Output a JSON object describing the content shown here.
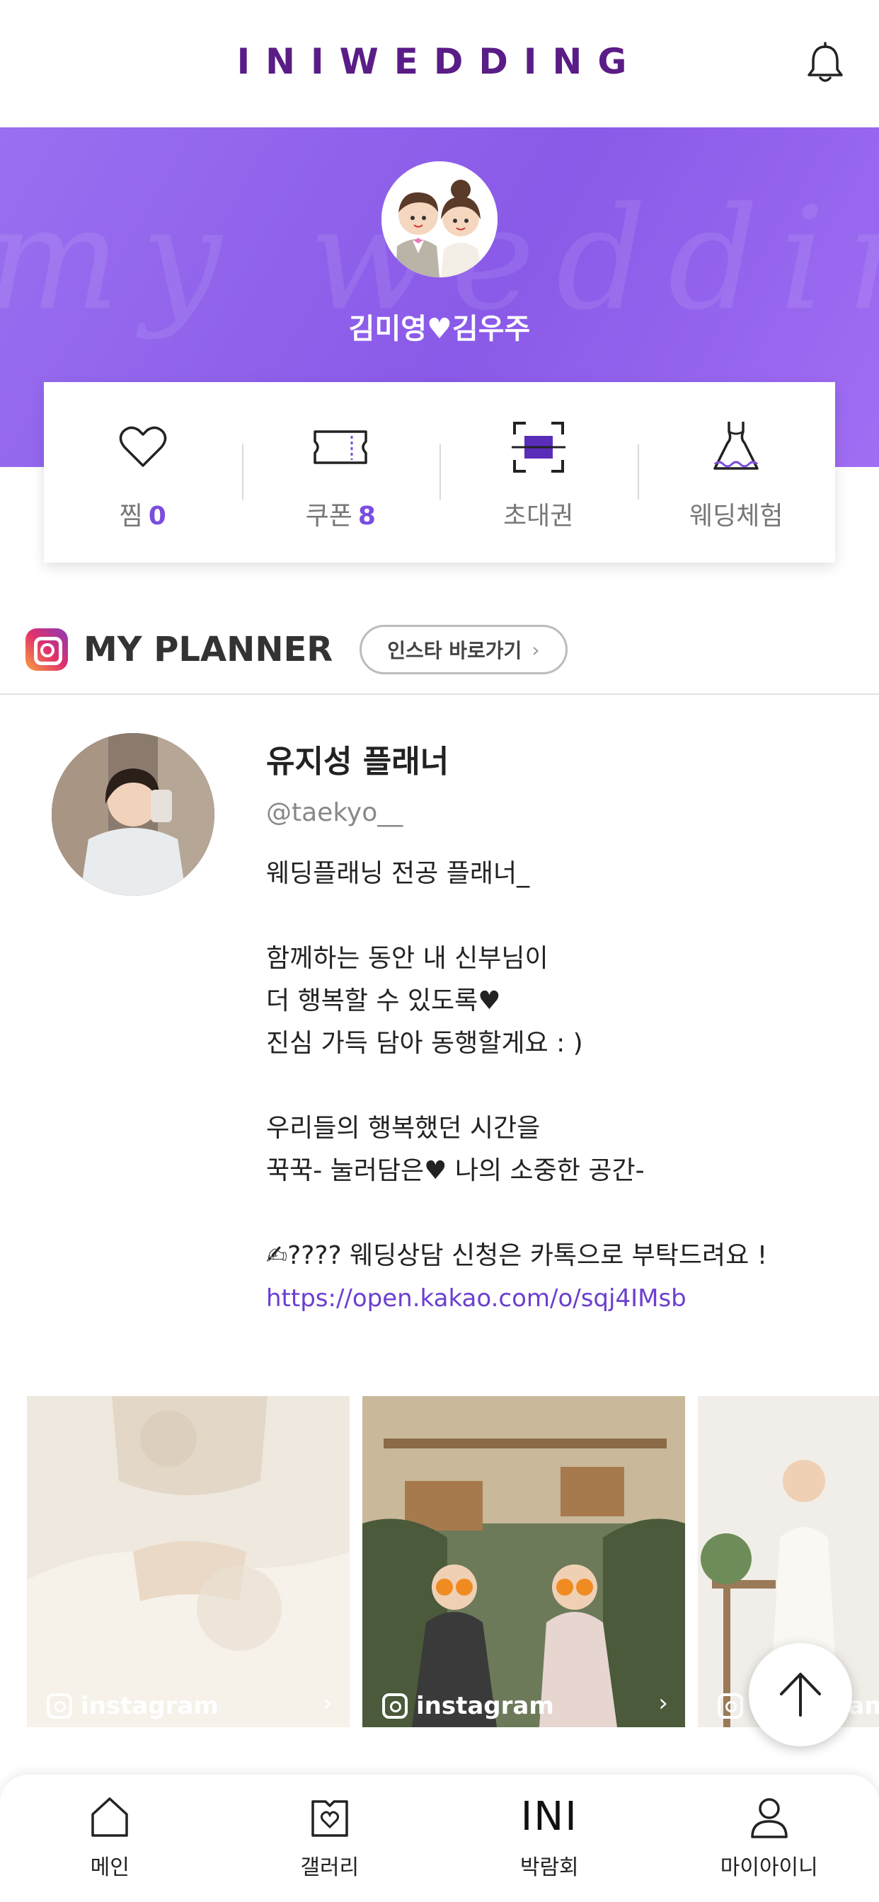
{
  "header": {
    "logo": "INIWEDDING",
    "bell_icon": "bell-icon"
  },
  "hero": {
    "background_script": "my wedding",
    "couple_name": "김미영♥김우주"
  },
  "stats": [
    {
      "icon": "heart-icon",
      "label": "찜",
      "count": "0"
    },
    {
      "icon": "ticket-icon",
      "label": "쿠폰",
      "count": "8"
    },
    {
      "icon": "invitation-icon",
      "label": "초대권",
      "count": ""
    },
    {
      "icon": "dress-icon",
      "label": "웨딩체험",
      "count": ""
    }
  ],
  "planner_section": {
    "title": "MY PLANNER",
    "insta_link": "인스타 바로가기",
    "chevron": "›"
  },
  "planner": {
    "name": "유지성 플래너",
    "handle": "@taekyo__",
    "bio": "웨딩플래닝 전공 플래너_\n\n함께하는 동안 내 신부님이\n더 행복할 수 있도록♥\n진심 가득 담아 동행할게요 : )\n\n우리들의 행복했던 시간을\n꾹꾹- 눌러담은♥ 나의 소중한 공간-\n\n✍???? 웨딩상담 신청은 카톡으로 부탁드려요 !",
    "link": "https://open.kakao.com/o/sqj4IMsb"
  },
  "gallery": [
    {
      "caption": "instagram",
      "chevron": "›"
    },
    {
      "caption": "instagram",
      "chevron": "›"
    },
    {
      "caption": "instagram",
      "chevron": "›"
    }
  ],
  "scroll_top_icon": "arrow-up-icon",
  "nav": [
    {
      "icon": "home-icon",
      "label": "메인"
    },
    {
      "icon": "gallery-icon",
      "label": "갤러리"
    },
    {
      "icon_text": "INI",
      "label": "박람회"
    },
    {
      "icon": "user-icon",
      "label": "마이아이니"
    }
  ],
  "colors": {
    "brand_purple": "#5a1c86",
    "hero_purple": "#8a5ae8",
    "accent": "#7a4de0",
    "link": "#6c3fd0"
  }
}
